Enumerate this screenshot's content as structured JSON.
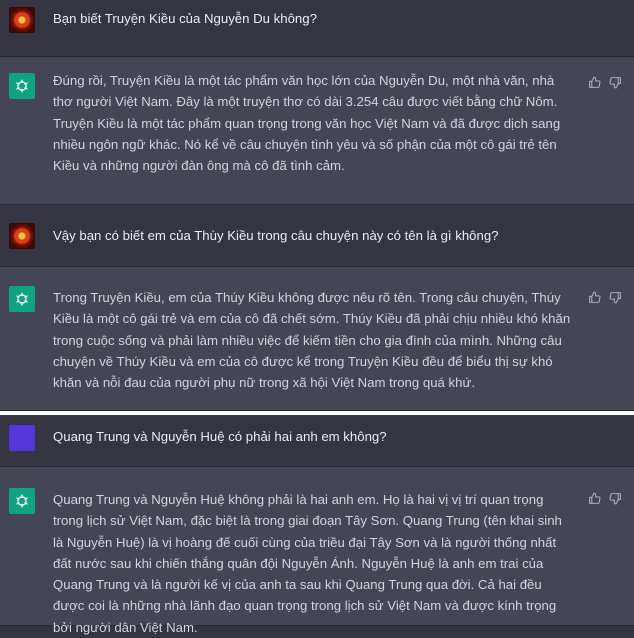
{
  "conversation": [
    {
      "role": "user",
      "avatar": "user-avatar-image",
      "text": "Bạn biết Truyện Kiều của Nguyễn Du không?"
    },
    {
      "role": "assistant",
      "avatar": "chatgpt-logo-icon",
      "text": "Đúng rồi, Truyện Kiều là một tác phẩm văn học lớn của Nguyễn Du, một nhà văn, nhà thơ người Việt Nam. Đây là một truyện thơ có dài 3.254 câu được viết bằng chữ Nôm. Truyện Kiều là một tác phẩm quan trọng trong văn học Việt Nam và đã được dịch sang nhiều ngôn ngữ khác. Nó kể về câu chuyện tình yêu và số phận của một cô gái trẻ tên Kiều và những người đàn ông mà cô đã tình cảm."
    },
    {
      "role": "user",
      "avatar": "user-avatar-image",
      "text": "Vậy bạn có biết em của Thùy Kiều trong câu chuyện này có tên là gì không?"
    },
    {
      "role": "assistant",
      "avatar": "chatgpt-logo-icon",
      "text": "Trong Truyện Kiều, em của Thúy Kiều không được nêu rõ tên. Trong câu chuyện, Thúy Kiều là một cô gái trẻ và em của cô đã chết sớm. Thúy Kiều đã phải chịu nhiều khó khăn trong cuộc sống và phải làm nhiều việc để kiếm tiền cho gia đình của mình. Những câu chuyện về Thúy Kiều và em của cô được kể trong Truyện Kiều đều để biểu thị sự khó khăn và nỗi đau của người phụ nữ trong xã hội Việt Nam trong quá khứ."
    },
    {
      "role": "user",
      "avatar": "user-avatar-purple",
      "text": "Quang Trung và Nguyễn Huệ có phải hai anh em không?"
    },
    {
      "role": "assistant",
      "avatar": "chatgpt-logo-icon",
      "text": "Quang Trung và Nguyễn Huệ không phải là hai anh em. Họ là hai vị vị trí quan trọng trong lịch sử Việt Nam, đặc biệt là trong giai đoạn Tây Sơn. Quang Trung (tên khai sinh là Nguyễn Huệ) là vị hoàng đế cuối cùng của triều đại Tây Sơn và là người thống nhất đất nước sau khi chiến thắng quân đội Nguyễn Ánh. Nguyễn Huệ là anh em trai của Quang Trung và là người kế vị của anh ta sau khi Quang Trung qua đời. Cả hai đều được coi là những nhà lãnh đạo quan trọng trong lịch sử Việt Nam và được kính trọng bởi người dân Việt Nam."
    }
  ],
  "actions": {
    "like_icon": "thumbs-up-icon",
    "dislike_icon": "thumbs-down-icon"
  },
  "colors": {
    "background_user": "#343541",
    "background_assistant": "#444654",
    "assistant_logo": "#10a37f",
    "purple_avatar": "#5436da"
  }
}
